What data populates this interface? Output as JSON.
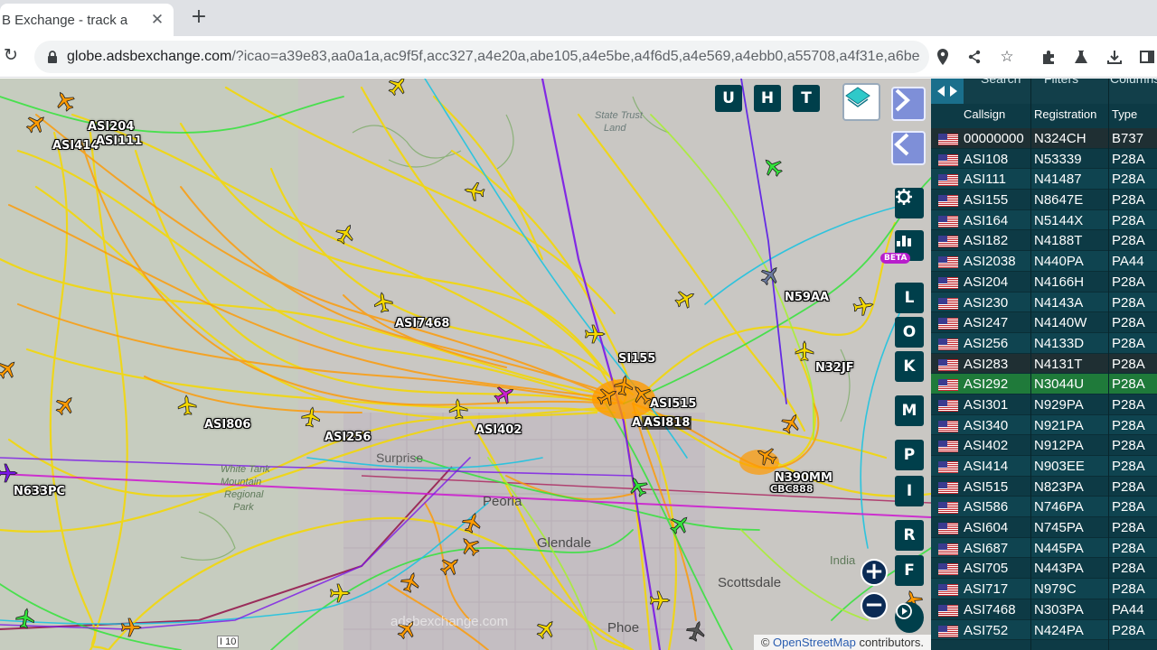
{
  "browser": {
    "tab_title": "B Exchange - track a",
    "tab_close": "✕",
    "new_tab": "+",
    "url_host": "globe.adsbexchange.com",
    "url_rest": "/?icao=a39e83,aa0a1a,ac9f5f,acc327,a4e20a,abe105,a4e5be,a4f6d5,a4e569,a4ebb0,a55708,a4f31e,a6be..."
  },
  "map": {
    "top_buttons": [
      "U",
      "H",
      "T"
    ],
    "side_buttons": [
      "L",
      "O",
      "K",
      "M",
      "P",
      "I",
      "R",
      "F"
    ],
    "beta_label": "BETA",
    "watermark": "adsbexchange.com",
    "attribution_prefix": "©",
    "attribution_link": "OpenStreetMap",
    "attribution_suffix": "contributors.",
    "place_labels": {
      "state_trust": "State Trust",
      "land": "Land",
      "surprise": "Surprise",
      "peoria": "Peoria",
      "glendale": "Glendale",
      "scottsdale": "Scottsdale",
      "phoenix": "Phoe",
      "white_tank": "White Tank",
      "mountain": "Mountain",
      "regional": "Regional",
      "park": "Park",
      "i10": "I 10",
      "indian": "India"
    },
    "aircraft_labels": {
      "asi204": "ASI204",
      "asi414": "ASI414",
      "asi111": "ASI111",
      "asi7468": "ASI7468",
      "n59aa": "N59AA",
      "n32jf": "N32JF",
      "si155": "SI155",
      "asi515": "ASI515",
      "asi818": "ASI818",
      "a_trunc": "A",
      "asi806": "ASI806",
      "asi256": "ASI256",
      "asi402": "ASI402",
      "n633pc": "N633PC",
      "n390mm": "N390MM",
      "cbc": "CBC888"
    },
    "colors": {
      "yellow": "#f5d800",
      "orange": "#ff9a00",
      "green": "#33e33a",
      "cyan": "#1ec3e0",
      "purple": "#7a16e8",
      "magenta": "#cc1fcf",
      "lime": "#a8f030"
    }
  },
  "panel": {
    "tabs": [
      "Search",
      "Filters",
      "Columns"
    ],
    "headers": {
      "callsign": "Callsign",
      "registration": "Registration",
      "type": "Type"
    },
    "rows": [
      {
        "callsign": "00000000",
        "reg": "N324CH",
        "type": "B737",
        "highlight": "dark"
      },
      {
        "callsign": "ASI108",
        "reg": "N53339",
        "type": "P28A"
      },
      {
        "callsign": "ASI111",
        "reg": "N41487",
        "type": "P28A"
      },
      {
        "callsign": "ASI155",
        "reg": "N8647E",
        "type": "P28A"
      },
      {
        "callsign": "ASI164",
        "reg": "N5144X",
        "type": "P28A"
      },
      {
        "callsign": "ASI182",
        "reg": "N4188T",
        "type": "P28A"
      },
      {
        "callsign": "ASI2038",
        "reg": "N440PA",
        "type": "PA44"
      },
      {
        "callsign": "ASI204",
        "reg": "N4166H",
        "type": "P28A"
      },
      {
        "callsign": "ASI230",
        "reg": "N4143A",
        "type": "P28A"
      },
      {
        "callsign": "ASI247",
        "reg": "N4140W",
        "type": "P28A"
      },
      {
        "callsign": "ASI256",
        "reg": "N4133D",
        "type": "P28A"
      },
      {
        "callsign": "ASI283",
        "reg": "N4131T",
        "type": "P28A",
        "highlight": "dark"
      },
      {
        "callsign": "ASI292",
        "reg": "N3044U",
        "type": "P28A",
        "highlight": "green"
      },
      {
        "callsign": "ASI301",
        "reg": "N929PA",
        "type": "P28A"
      },
      {
        "callsign": "ASI340",
        "reg": "N921PA",
        "type": "P28A"
      },
      {
        "callsign": "ASI402",
        "reg": "N912PA",
        "type": "P28A"
      },
      {
        "callsign": "ASI414",
        "reg": "N903EE",
        "type": "P28A"
      },
      {
        "callsign": "ASI515",
        "reg": "N823PA",
        "type": "P28A"
      },
      {
        "callsign": "ASI586",
        "reg": "N746PA",
        "type": "P28A"
      },
      {
        "callsign": "ASI604",
        "reg": "N745PA",
        "type": "P28A"
      },
      {
        "callsign": "ASI687",
        "reg": "N445PA",
        "type": "P28A"
      },
      {
        "callsign": "ASI705",
        "reg": "N443PA",
        "type": "P28A"
      },
      {
        "callsign": "ASI717",
        "reg": "N979C",
        "type": "P28A"
      },
      {
        "callsign": "ASI7468",
        "reg": "N303PA",
        "type": "PA44"
      },
      {
        "callsign": "ASI752",
        "reg": "N424PA",
        "type": "P28A"
      }
    ]
  }
}
